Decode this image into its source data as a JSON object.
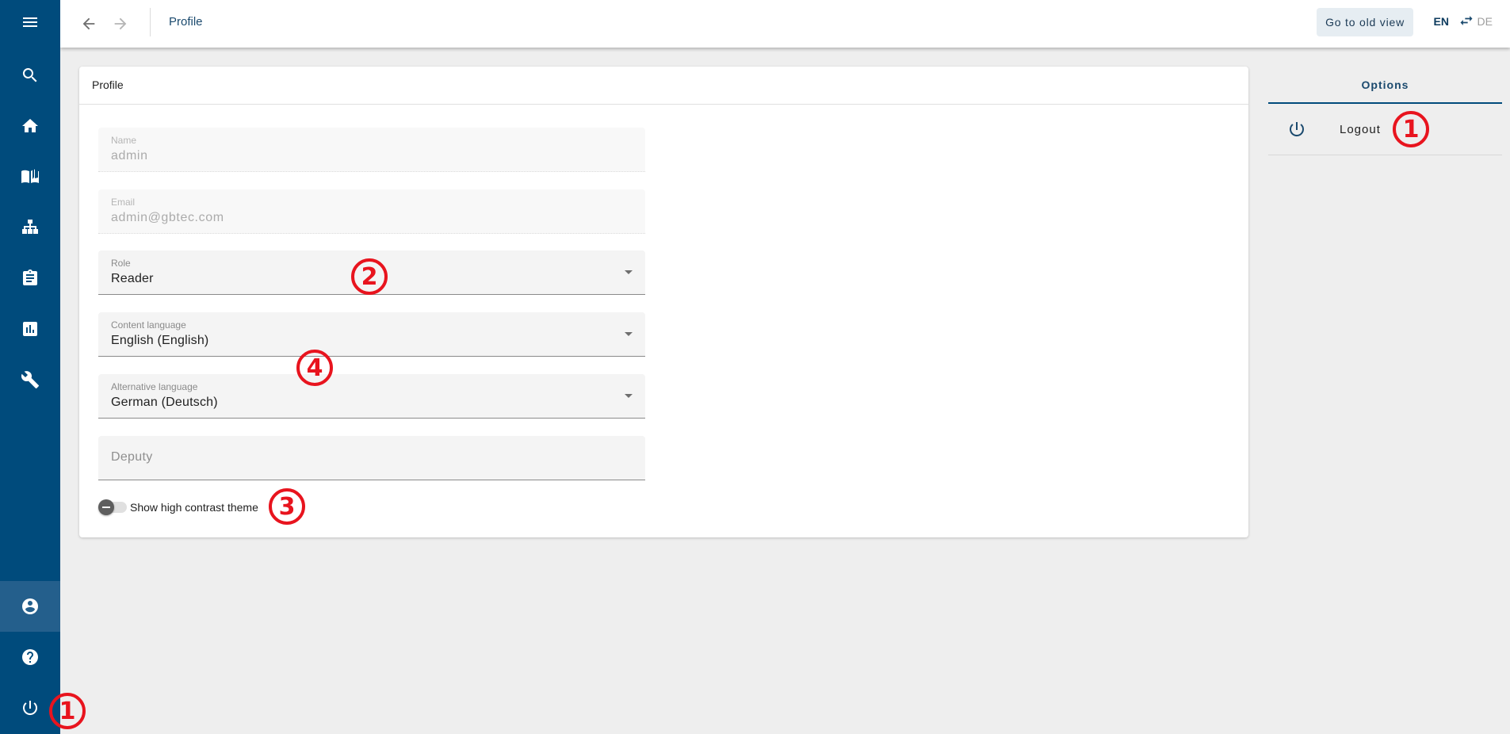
{
  "sidebar": {
    "top_items": [
      {
        "name": "menu",
        "icon": "menu-icon"
      },
      {
        "name": "search",
        "icon": "search-icon"
      },
      {
        "name": "home",
        "icon": "home-icon"
      },
      {
        "name": "book",
        "icon": "book-icon"
      },
      {
        "name": "sitemap",
        "icon": "sitemap-icon"
      },
      {
        "name": "clipboard",
        "icon": "clipboard-icon"
      },
      {
        "name": "reports",
        "icon": "bar-chart-icon"
      },
      {
        "name": "tools",
        "icon": "wrench-icon"
      }
    ],
    "bottom_items": [
      {
        "name": "profile",
        "icon": "account-circle-icon",
        "active": true
      },
      {
        "name": "help",
        "icon": "help-icon"
      },
      {
        "name": "logout",
        "icon": "power-icon"
      }
    ],
    "color": "#004b7c",
    "active_color": "#245f8c"
  },
  "header": {
    "title": "Profile",
    "old_view_button": "Go to old view",
    "lang_active": "EN",
    "lang_inactive": "DE"
  },
  "card": {
    "title": "Profile",
    "fields": {
      "name": {
        "label": "Name",
        "value": "admin"
      },
      "email": {
        "label": "Email",
        "value": "admin@gbtec.com"
      },
      "role": {
        "label": "Role",
        "value": "Reader"
      },
      "content_language": {
        "label": "Content language",
        "value": "English (English)"
      },
      "alternative_language": {
        "label": "Alternative language",
        "value": "German (Deutsch)"
      },
      "deputy": {
        "placeholder": "Deputy"
      }
    },
    "high_contrast": {
      "label": "Show high contrast theme",
      "enabled": false
    }
  },
  "options": {
    "tab_label": "Options",
    "items": [
      {
        "label": "Logout",
        "icon": "power-icon"
      }
    ]
  },
  "annotations": {
    "a1_sidebar": "1",
    "a1_options": "1",
    "a2": "2",
    "a3": "3",
    "a4": "4",
    "color": "#e8141e"
  }
}
